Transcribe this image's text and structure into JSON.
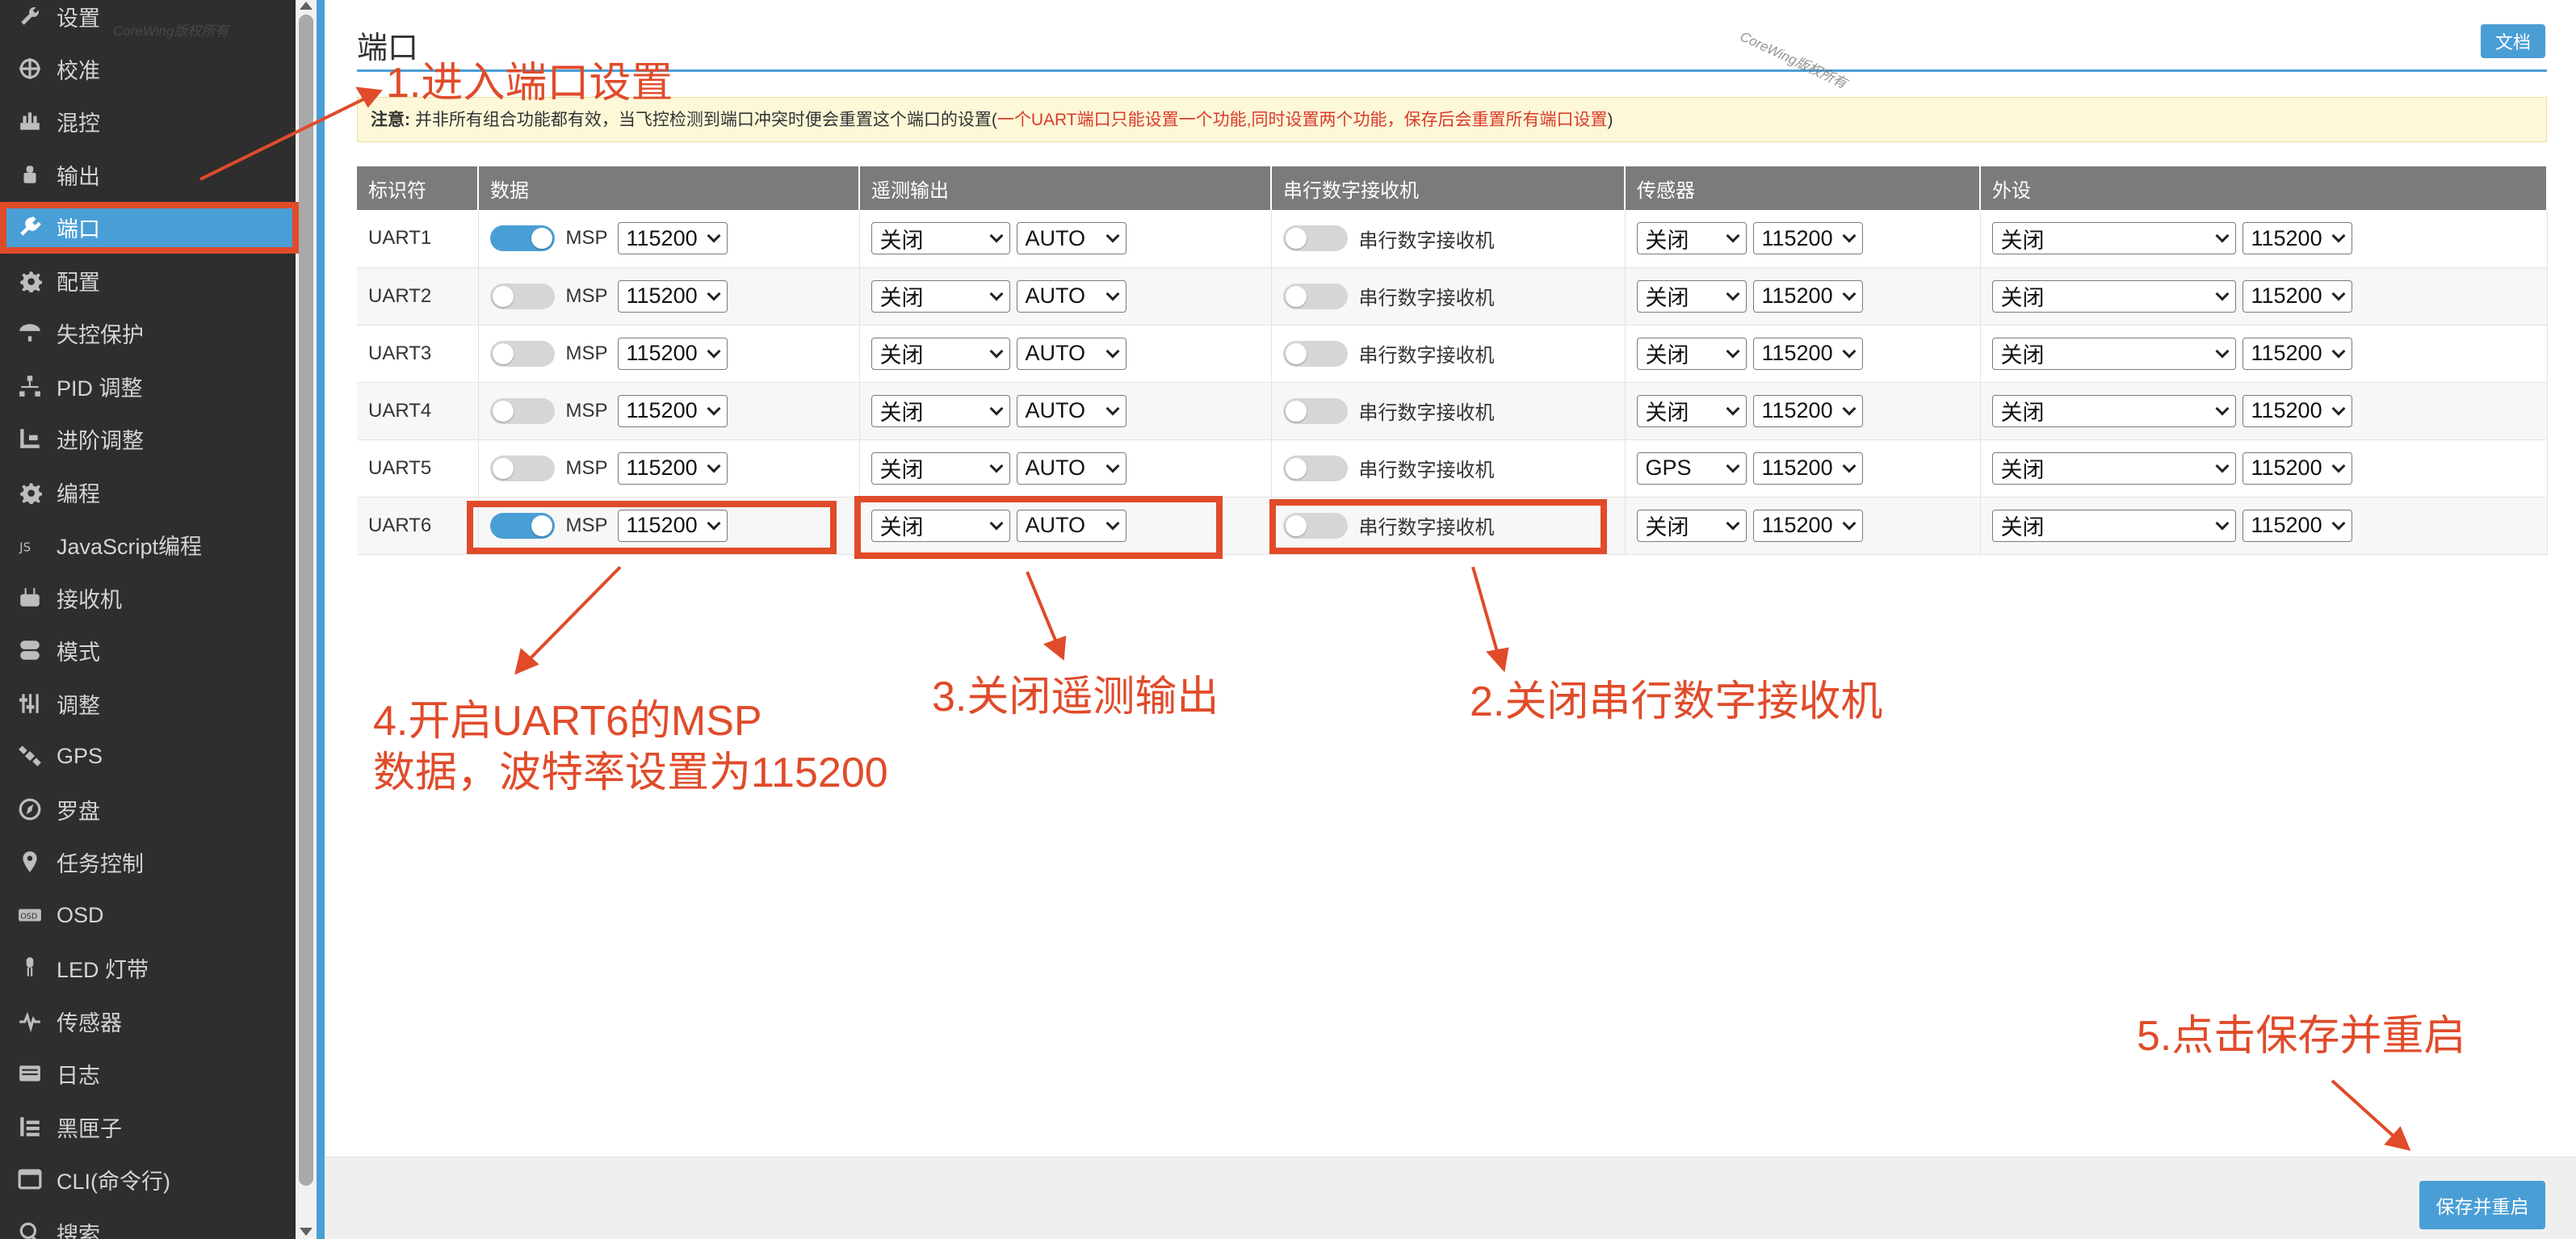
{
  "sidebar": {
    "items": [
      {
        "label": "设置",
        "icon": "wrench-icon"
      },
      {
        "label": "校准",
        "icon": "crosshair-icon"
      },
      {
        "label": "混控",
        "icon": "mixer-icon"
      },
      {
        "label": "输出",
        "icon": "motor-icon"
      },
      {
        "label": "端口",
        "icon": "plug-icon",
        "active": true
      },
      {
        "label": "配置",
        "icon": "gear-icon"
      },
      {
        "label": "失控保护",
        "icon": "parachute-icon"
      },
      {
        "label": "PID 调整",
        "icon": "pid-icon"
      },
      {
        "label": "进阶调整",
        "icon": "advanced-tuning-icon"
      },
      {
        "label": "编程",
        "icon": "gear-icon"
      },
      {
        "label": "JavaScript编程",
        "icon": "js-icon"
      },
      {
        "label": "接收机",
        "icon": "receiver-icon"
      },
      {
        "label": "模式",
        "icon": "toggle-icon"
      },
      {
        "label": "调整",
        "icon": "sliders-icon"
      },
      {
        "label": "GPS",
        "icon": "satellite-icon"
      },
      {
        "label": "罗盘",
        "icon": "compass-icon"
      },
      {
        "label": "任务控制",
        "icon": "map-pin-icon"
      },
      {
        "label": "OSD",
        "icon": "osd-icon"
      },
      {
        "label": "LED 灯带",
        "icon": "led-icon"
      },
      {
        "label": "传感器",
        "icon": "pulse-icon"
      },
      {
        "label": "日志",
        "icon": "log-icon"
      },
      {
        "label": "黑匣子",
        "icon": "blackbox-icon"
      },
      {
        "label": "CLI(命令行)",
        "icon": "terminal-icon"
      },
      {
        "label": "搜索",
        "icon": "search-icon"
      }
    ],
    "active_color": "#4a9ed6"
  },
  "header": {
    "title": "端口",
    "doc_button": "文档"
  },
  "notice": {
    "bold": "注意:",
    "text": " 并非所有组合功能都有效，当飞控检测到端口冲突时便会重置这个端口的设置(",
    "red": "一个UART端口只能设置一个功能,同时设置两个功能，保存后会重置所有端口设置",
    "end": ")"
  },
  "table": {
    "headers": [
      "标识符",
      "数据",
      "遥测输出",
      "串行数字接收机",
      "传感器",
      "外设"
    ],
    "msp_label": "MSP",
    "rx_label": "串行数字接收机",
    "rows": [
      {
        "id": "UART1",
        "msp_on": true,
        "msp_baud": "115200",
        "telemetry": "关闭",
        "telemetry_baud": "AUTO",
        "rx_on": false,
        "sensor": "关闭",
        "sensor_baud": "115200",
        "peripheral": "关闭",
        "peripheral_baud": "115200"
      },
      {
        "id": "UART2",
        "msp_on": false,
        "msp_baud": "115200",
        "telemetry": "关闭",
        "telemetry_baud": "AUTO",
        "rx_on": false,
        "sensor": "关闭",
        "sensor_baud": "115200",
        "peripheral": "关闭",
        "peripheral_baud": "115200"
      },
      {
        "id": "UART3",
        "msp_on": false,
        "msp_baud": "115200",
        "telemetry": "关闭",
        "telemetry_baud": "AUTO",
        "rx_on": false,
        "sensor": "关闭",
        "sensor_baud": "115200",
        "peripheral": "关闭",
        "peripheral_baud": "115200"
      },
      {
        "id": "UART4",
        "msp_on": false,
        "msp_baud": "115200",
        "telemetry": "关闭",
        "telemetry_baud": "AUTO",
        "rx_on": false,
        "sensor": "关闭",
        "sensor_baud": "115200",
        "peripheral": "关闭",
        "peripheral_baud": "115200"
      },
      {
        "id": "UART5",
        "msp_on": false,
        "msp_baud": "115200",
        "telemetry": "关闭",
        "telemetry_baud": "AUTO",
        "rx_on": false,
        "sensor": "GPS",
        "sensor_baud": "115200",
        "peripheral": "关闭",
        "peripheral_baud": "115200"
      },
      {
        "id": "UART6",
        "msp_on": true,
        "msp_baud": "115200",
        "telemetry": "关闭",
        "telemetry_baud": "AUTO",
        "rx_on": false,
        "sensor": "关闭",
        "sensor_baud": "115200",
        "peripheral": "关闭",
        "peripheral_baud": "115200"
      }
    ]
  },
  "annotations": {
    "step1": "1.进入端口设置",
    "step2": "2.关闭串行数字接收机",
    "step3": "3.关闭遥测输出",
    "step4_line1": "4.开启UART6的MSP",
    "step4_line2": "数据，波特率设置为115200",
    "step5": "5.点击保存并重启",
    "color": "#e04b2a"
  },
  "watermarks": [
    "CoreWing版权所有",
    "CoreWing版权所有"
  ],
  "footer": {
    "save_button": "保存并重启"
  }
}
